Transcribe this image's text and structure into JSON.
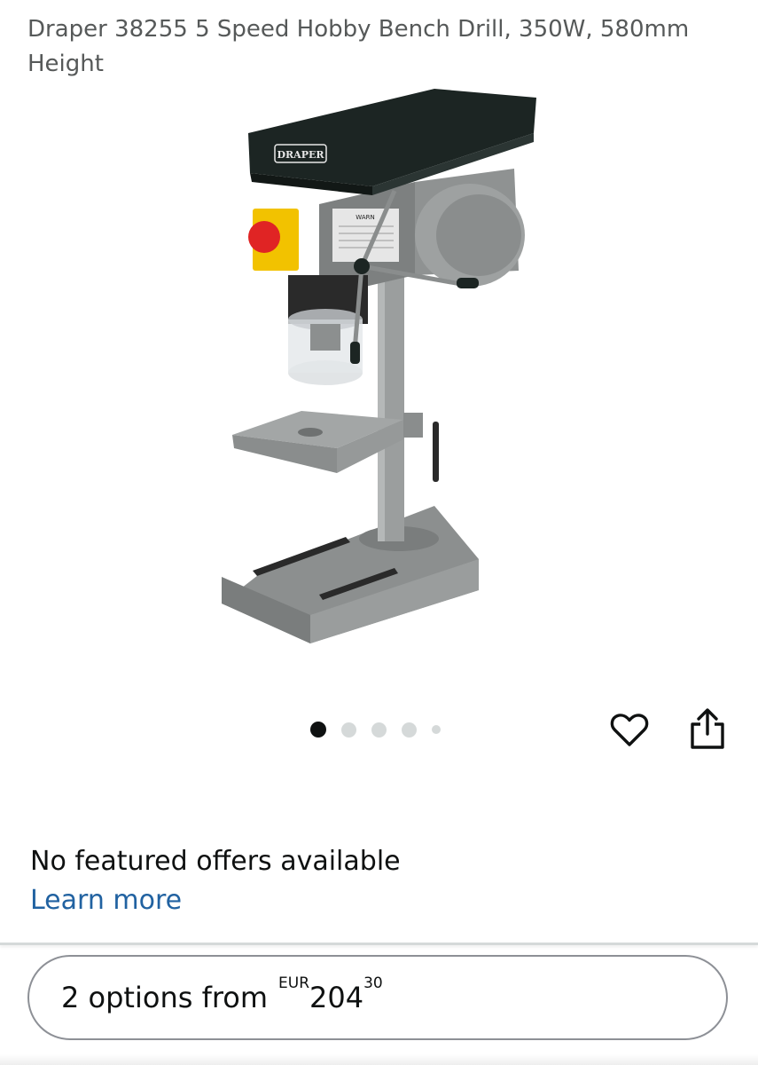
{
  "product": {
    "title": "Draper 38255 5 Speed Hobby Bench Drill, 350W, 580mm Height",
    "image": {
      "icon": "bench-drill-press-image",
      "brand_label": "DRAPER",
      "warning_label": "WARN",
      "colors": {
        "head": "#1c2523",
        "body": "#8a8d8d",
        "switch_yellow": "#f2c200",
        "stop_red": "#e02424"
      }
    }
  },
  "carousel": {
    "count": 5,
    "active_index": 0
  },
  "actions": {
    "wishlist_icon": "heart-outline-icon",
    "share_icon": "share-icon"
  },
  "offers": {
    "status": "No featured offers available",
    "learn_more": "Learn more"
  },
  "buy_options": {
    "label": "2 options from",
    "currency": "EUR",
    "price_whole": "204",
    "price_fraction": "30"
  },
  "colors": {
    "link": "#2162a1",
    "text": "#0f1111",
    "secondary_text": "#565959",
    "border": "#8d9096"
  }
}
